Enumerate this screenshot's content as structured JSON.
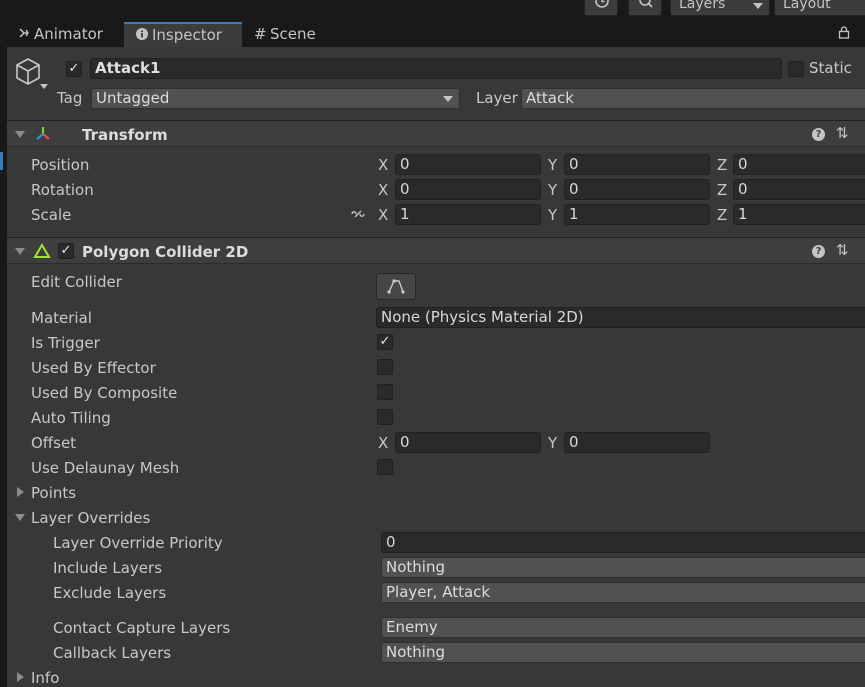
{
  "toolbar": {
    "history_icon": "history-icon",
    "search_icon": "search-icon",
    "layers_label": "Layers",
    "layout_label": "Layout"
  },
  "tabs": [
    {
      "label": "Animator",
      "icon": "animator-icon"
    },
    {
      "label": "Inspector",
      "icon": "info-icon"
    },
    {
      "label": "Scene",
      "icon": "grid-icon"
    }
  ],
  "header": {
    "object_name": "Attack1",
    "active": true,
    "static_label": "Static",
    "static": false,
    "tag_label": "Tag",
    "tag_value": "Untagged",
    "layer_label": "Layer",
    "layer_value": "Attack"
  },
  "transform": {
    "title": "Transform",
    "rows": [
      {
        "label": "Position",
        "x": "0",
        "y": "0",
        "z": "0"
      },
      {
        "label": "Rotation",
        "x": "0",
        "y": "0",
        "z": "0"
      },
      {
        "label": "Scale",
        "x": "1",
        "y": "1",
        "z": "1"
      }
    ],
    "axis_x": "X",
    "axis_y": "Y",
    "axis_z": "Z"
  },
  "collider": {
    "title": "Polygon Collider 2D",
    "enabled": true,
    "edit_collider_label": "Edit Collider",
    "material_label": "Material",
    "material_value": "None (Physics Material 2D)",
    "is_trigger_label": "Is Trigger",
    "is_trigger": true,
    "used_by_effector_label": "Used By Effector",
    "used_by_effector": false,
    "used_by_composite_label": "Used By Composite",
    "used_by_composite": false,
    "auto_tiling_label": "Auto Tiling",
    "auto_tiling": false,
    "offset_label": "Offset",
    "offset_x": "0",
    "offset_y": "0",
    "delaunay_label": "Use Delaunay Mesh",
    "delaunay": false,
    "points_label": "Points",
    "layer_overrides_label": "Layer Overrides",
    "override_priority_label": "Layer Override Priority",
    "override_priority_value": "0",
    "include_layers_label": "Include Layers",
    "include_layers_value": "Nothing",
    "exclude_layers_label": "Exclude Layers",
    "exclude_layers_value": "Player, Attack",
    "contact_capture_label": "Contact Capture Layers",
    "contact_capture_value": "Enemy",
    "callback_layers_label": "Callback Layers",
    "callback_layers_value": "Nothing",
    "info_label": "Info"
  },
  "colors": {
    "accent": "#3a79bb",
    "panel": "#383838",
    "header": "#3e3e3e",
    "field": "#2a2a2a",
    "collider_icon": "#9be33a"
  }
}
